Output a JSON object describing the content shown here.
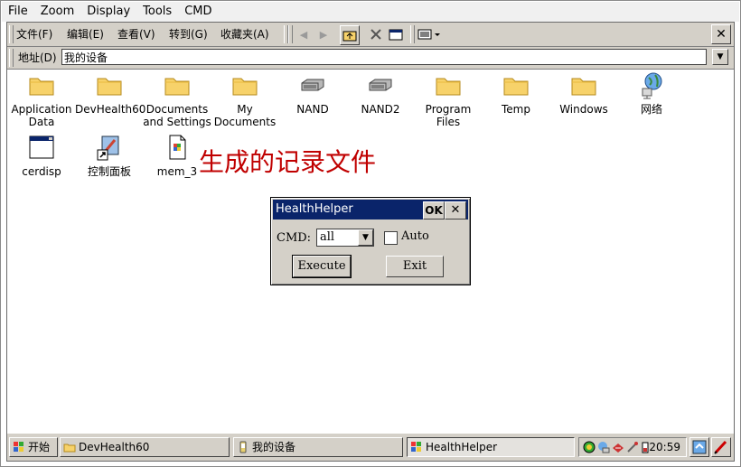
{
  "host_menu": [
    "File",
    "Zoom",
    "Display",
    "Tools",
    "CMD"
  ],
  "menubar": [
    "文件(F)",
    "编辑(E)",
    "查看(V)",
    "转到(G)",
    "收藏夹(A)"
  ],
  "toolbar": {
    "close_glyph": "✕"
  },
  "address": {
    "label": "地址(D)",
    "value": "我的设备"
  },
  "icons": [
    {
      "label": "Application Data",
      "type": "folder"
    },
    {
      "label": "DevHealth60",
      "type": "folder"
    },
    {
      "label": "Documents and Settings",
      "type": "folder"
    },
    {
      "label": "My Documents",
      "type": "folder"
    },
    {
      "label": "NAND",
      "type": "drive"
    },
    {
      "label": "NAND2",
      "type": "drive"
    },
    {
      "label": "Program Files",
      "type": "folder"
    },
    {
      "label": "Temp",
      "type": "folder"
    },
    {
      "label": "Windows",
      "type": "folder"
    },
    {
      "label": "网络",
      "type": "network"
    },
    {
      "label": "cerdisp",
      "type": "app"
    },
    {
      "label": "控制面板",
      "type": "shortcut"
    },
    {
      "label": "mem_3",
      "type": "file"
    }
  ],
  "annotation": "生成的记录文件",
  "dialog": {
    "title": "HealthHelper",
    "ok": "OK",
    "close": "✕",
    "cmd_label": "CMD:",
    "cmd_value": "all",
    "auto_label": "Auto",
    "execute": "Execute",
    "exit": "Exit"
  },
  "taskbar": {
    "start": "开始",
    "tasks": [
      "DevHealth60",
      "我的设备",
      "HealthHelper"
    ],
    "clock": "20:59"
  },
  "colors": {
    "title_bar": "#0a246a",
    "annotation": "#c00000",
    "chrome": "#d4d0c8"
  }
}
